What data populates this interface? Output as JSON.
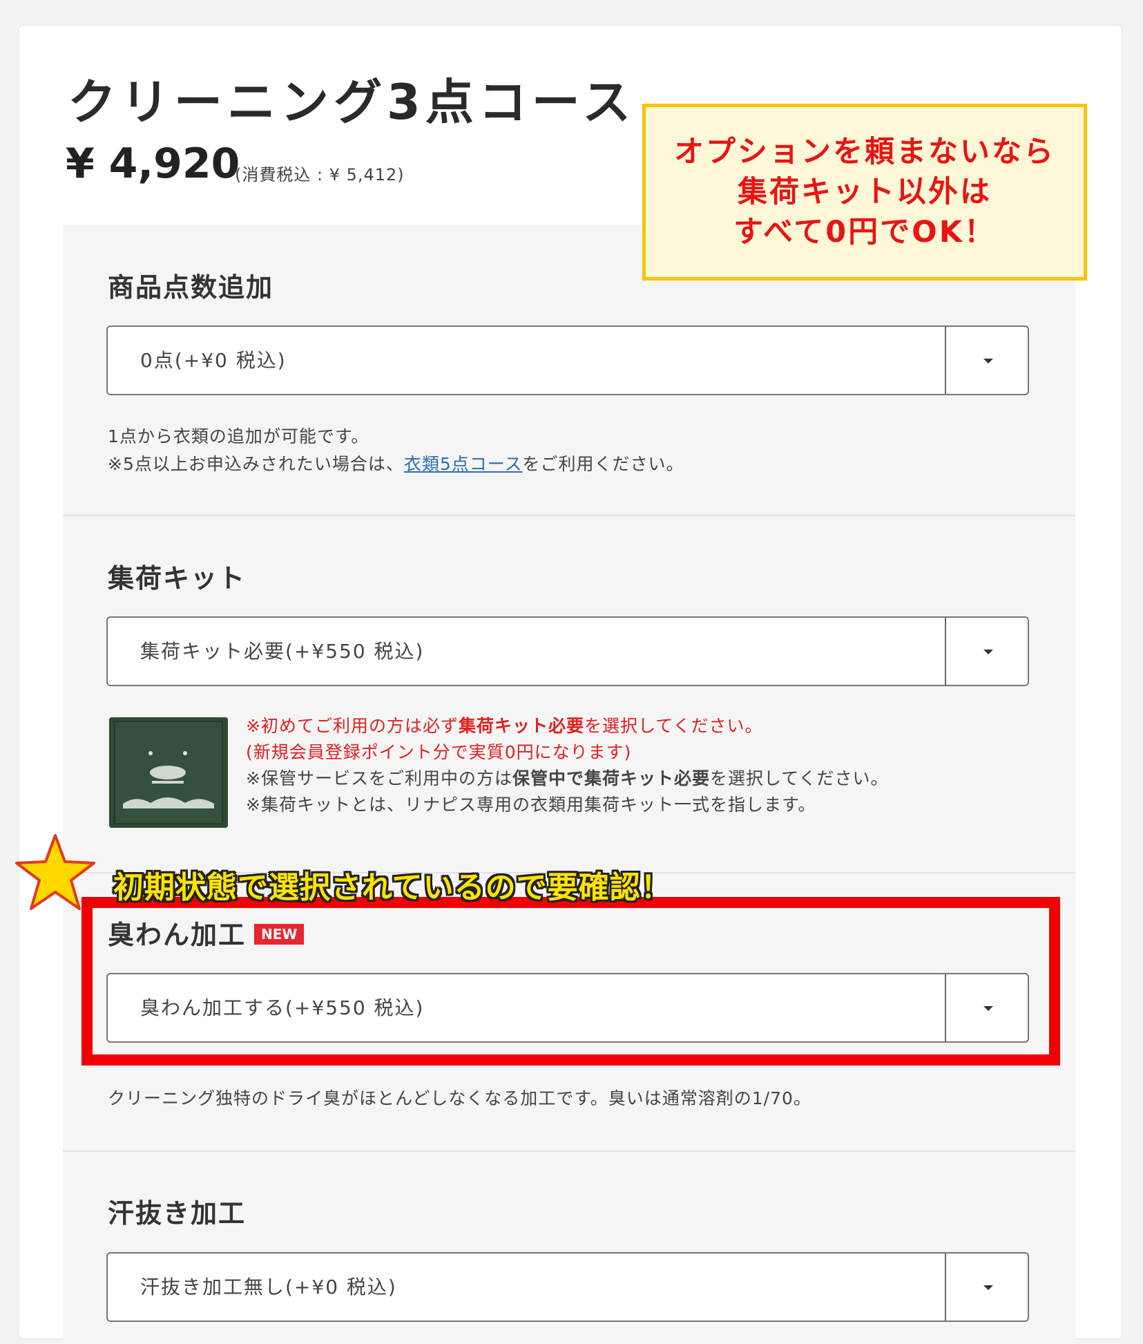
{
  "product": {
    "title": "クリーニング3点コース",
    "price": "¥ 4,920",
    "price_tax": "(消費税込 : ¥ 5,412)"
  },
  "callout": {
    "lines": [
      "オプションを頼まないなら",
      "集荷キット以外は",
      "すべて0円でOK！"
    ]
  },
  "sections": {
    "quantity": {
      "title": "商品点数追加",
      "select_value": "0点(+¥0 税込)",
      "note_line1": "1点から衣類の追加が可能です。",
      "note_line2_pre": "※5点以上お申込みされたい場合は、",
      "note_line2_link": "衣類5点コース",
      "note_line2_post": "をご利用ください。"
    },
    "kit": {
      "title": "集荷キット",
      "select_value": "集荷キット必要(+¥550 税込)",
      "note1_pre": "※初めてご利用の方は必ず",
      "note1_bold": "集荷キット必要",
      "note1_post": "を選択してください。",
      "note2": "(新規会員登録ポイント分で実質0円になります)",
      "note3_pre": "※保管サービスをご利用中の方は",
      "note3_bold": "保管中で集荷キット必要",
      "note3_post": "を選択してください。",
      "note4": "※集荷キットとは、リナピス専用の衣類用集荷キット一式を指します。"
    },
    "deodorant": {
      "title": "臭わん加工",
      "badge": "NEW",
      "select_value": "臭わん加工する(+¥550 税込)",
      "note": "クリーニング独特のドライ臭がほとんどしなくなる加工です。臭いは通常溶剤の1/70。"
    },
    "sweat": {
      "title": "汗抜き加工",
      "select_value": "汗抜き加工無し(+¥0 税込)"
    }
  },
  "annotation": {
    "text": "初期状態で選択されているので要確認！"
  },
  "colors": {
    "callout_border": "#f5c400",
    "callout_text": "#e81414",
    "highlight_border": "#f00000",
    "annotation_text": "#ffe400",
    "badge": "#e8262d",
    "link": "#2a6fb5"
  }
}
